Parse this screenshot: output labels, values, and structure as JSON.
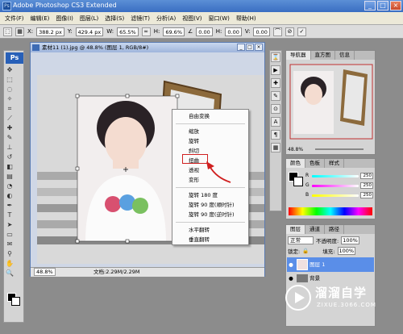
{
  "window": {
    "title": "Adobe Photoshop CS3 Extended",
    "app_icon": "Ps"
  },
  "menu": [
    "文件(F)",
    "编辑(E)",
    "图像(I)",
    "图层(L)",
    "选择(S)",
    "滤镜(T)",
    "分析(A)",
    "视图(V)",
    "窗口(W)",
    "帮助(H)"
  ],
  "options": {
    "x_label": "X:",
    "x_value": "388.2 px",
    "y_label": "Y:",
    "y_value": "429.4 px",
    "w_label": "W:",
    "w_value": "65.5%",
    "h_label": "H:",
    "h_value": "69.6%",
    "rotate_value": "0.00",
    "h2_label": "H:",
    "h2_value": "0.00",
    "v_label": "V:",
    "v_value": "0.00"
  },
  "toolbox": {
    "logo": "Ps"
  },
  "document": {
    "title": "素材11 (1).jpg @ 48.8% (图层 1, RGB/8#)",
    "zoom": "48.8%",
    "doc_info": "文档:2.29M/2.29M"
  },
  "context_menu": {
    "items": [
      "自由变换",
      "缩放",
      "旋转",
      "斜切",
      "扭曲",
      "透视",
      "变形",
      "旋转 180 度",
      "旋转 90 度(顺时针)",
      "旋转 90 度(逆时针)",
      "水平翻转",
      "垂直翻转"
    ],
    "highlighted": "扭曲"
  },
  "navigator": {
    "tabs": [
      "导航器",
      "直方图",
      "信息"
    ],
    "zoom": "48.8%"
  },
  "color_panel": {
    "tabs": [
      "颜色",
      "色板",
      "样式"
    ],
    "r_label": "R",
    "r_value": "250",
    "g_label": "G",
    "g_value": "250",
    "b_label": "B",
    "b_value": "250"
  },
  "layers_panel": {
    "tabs": [
      "图层",
      "通道",
      "路径"
    ],
    "blend_mode": "正常",
    "opacity_label": "不透明度:",
    "opacity_value": "100%",
    "lock_label": "锁定:",
    "fill_label": "填充:",
    "fill_value": "100%",
    "layers": [
      "图层 1",
      "背景"
    ]
  },
  "watermark": {
    "brand": "溜溜自学",
    "url": "ZIXUE.3066.COM"
  },
  "colors": {
    "accent": "#3a6ec2",
    "highlight": "#d02020",
    "layer_selected": "#5a8ee8"
  }
}
